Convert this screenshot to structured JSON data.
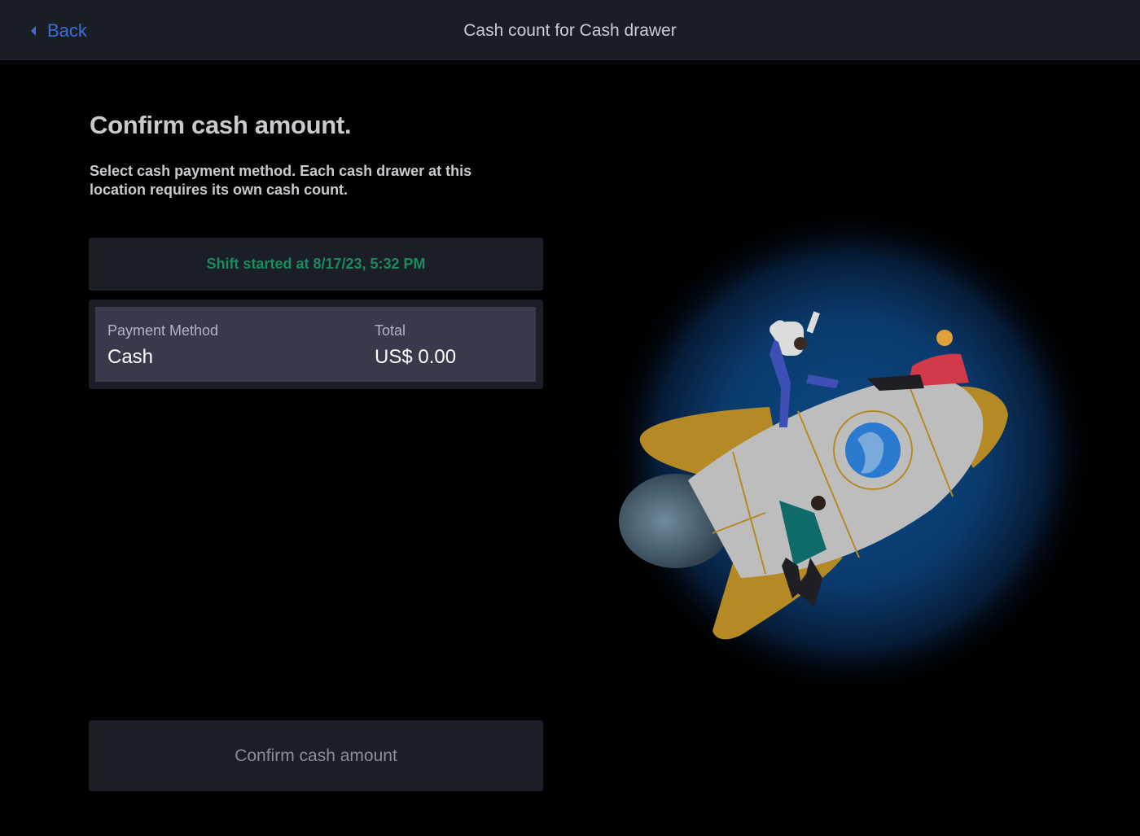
{
  "header": {
    "back_label": "Back",
    "title": "Cash count for Cash drawer"
  },
  "main": {
    "title": "Confirm cash amount.",
    "subtitle": "Select cash payment method. Each cash drawer at this location requires its own cash count.",
    "shift_banner": "Shift started at 8/17/23, 5:32 PM",
    "payment_table": {
      "method_header": "Payment Method",
      "total_header": "Total",
      "method_value": "Cash",
      "total_value": "US$ 0.00"
    },
    "confirm_button": "Confirm cash amount"
  },
  "icons": {
    "back": "chevron-left-icon",
    "illustration": "rocket-illustration"
  },
  "colors": {
    "accent_link": "#3b6ed8",
    "shift_text": "#1b8a5e",
    "header_bg": "#1a1d24",
    "card_bg": "#1b1e26",
    "row_bg": "#363a4b",
    "rocket_wing": "#b58a25",
    "rocket_body": "#bdbdbd",
    "glow": "#0c4a86"
  }
}
